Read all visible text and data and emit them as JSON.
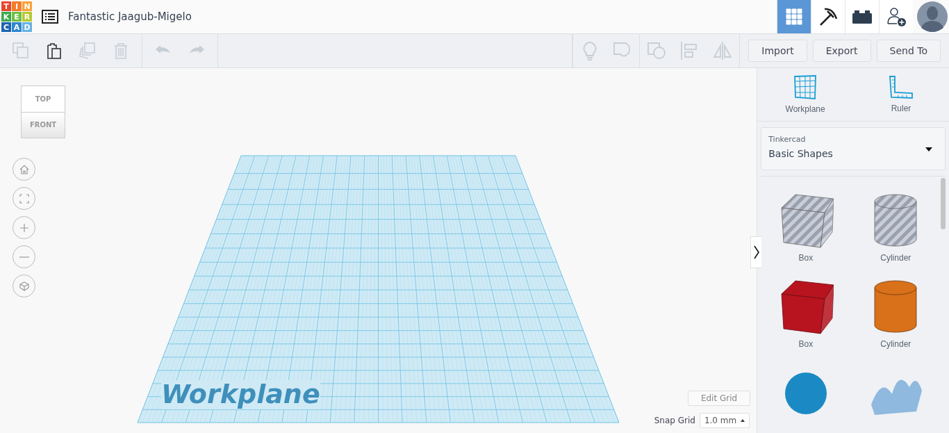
{
  "logo": [
    {
      "text": "T",
      "color": "#e8452c"
    },
    {
      "text": "I",
      "color": "#f47b2a"
    },
    {
      "text": "N",
      "color": "#f8a23a"
    },
    {
      "text": "K",
      "color": "#3da94a"
    },
    {
      "text": "E",
      "color": "#6fbf44"
    },
    {
      "text": "R",
      "color": "#b5c932"
    },
    {
      "text": "C",
      "color": "#1d65b0"
    },
    {
      "text": "A",
      "color": "#2f86cf"
    },
    {
      "text": "D",
      "color": "#68b2e3"
    }
  ],
  "design_title": "Fantastic Jaagub-Migelo",
  "view_tabs": [
    {
      "kind": "grid",
      "selected": true
    },
    {
      "kind": "pickaxe",
      "selected": false
    },
    {
      "kind": "brick",
      "selected": false
    },
    {
      "kind": "add-user",
      "selected": false
    }
  ],
  "edit_tools": [
    {
      "kind": "copy",
      "disabled": true
    },
    {
      "kind": "paste",
      "disabled": false
    },
    {
      "kind": "duplicate",
      "disabled": true
    },
    {
      "kind": "delete",
      "disabled": true
    }
  ],
  "history_tools": [
    {
      "kind": "undo",
      "disabled": true
    },
    {
      "kind": "redo",
      "disabled": true
    }
  ],
  "shape_tools": [
    {
      "kind": "bulb",
      "disabled": true
    },
    {
      "kind": "group",
      "disabled": true
    },
    {
      "kind": "ungroup",
      "disabled": true
    },
    {
      "kind": "align",
      "disabled": true
    },
    {
      "kind": "mirror",
      "disabled": true
    }
  ],
  "action_buttons": [
    "Import",
    "Export",
    "Send To"
  ],
  "view_cube": {
    "top": "TOP",
    "front": "FRONT"
  },
  "view_controls": [
    {
      "kind": "home"
    },
    {
      "kind": "fit"
    },
    {
      "kind": "zoom-in"
    },
    {
      "kind": "zoom-out"
    },
    {
      "kind": "perspective"
    }
  ],
  "workplane_label": "Workplane",
  "edit_grid": "Edit Grid",
  "snap_grid": {
    "label": "Snap Grid",
    "value": "1.0 mm"
  },
  "panel_tools": [
    {
      "kind": "workplane",
      "label": "Workplane"
    },
    {
      "kind": "ruler",
      "label": "Ruler"
    }
  ],
  "library": {
    "source": "Tinkercad",
    "selection": "Basic Shapes"
  },
  "shapes": [
    {
      "kind": "box",
      "hole": true,
      "label": "Box"
    },
    {
      "kind": "cylinder",
      "hole": true,
      "label": "Cylinder"
    },
    {
      "kind": "box",
      "hole": false,
      "color": "#b8141f",
      "label": "Box"
    },
    {
      "kind": "cylinder",
      "hole": false,
      "color": "#d9701a",
      "label": "Cylinder"
    },
    {
      "kind": "sphere",
      "color": "#1b8ac4"
    },
    {
      "kind": "scribble",
      "color": "#8fb9de"
    }
  ]
}
